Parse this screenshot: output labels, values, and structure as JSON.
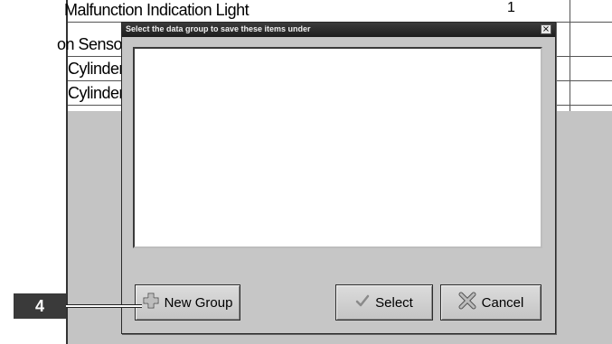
{
  "background": {
    "rows": [
      {
        "text": "Malfunction Indication Light",
        "value": "1"
      },
      {
        "text": "on Sensor",
        "value": ""
      },
      {
        "text": "Cylinder",
        "value": ""
      },
      {
        "text": "Cylinder",
        "value": ""
      }
    ]
  },
  "dialog": {
    "title": "Select the data group to save these items under",
    "close_glyph": "×",
    "buttons": {
      "new_group": "New Group",
      "select": "Select",
      "cancel": "Cancel"
    }
  },
  "callout": {
    "label": "4"
  },
  "icons": {
    "new_group": "plus-icon",
    "select": "checkmark-icon",
    "cancel": "x-cross-icon",
    "close": "close-icon"
  }
}
